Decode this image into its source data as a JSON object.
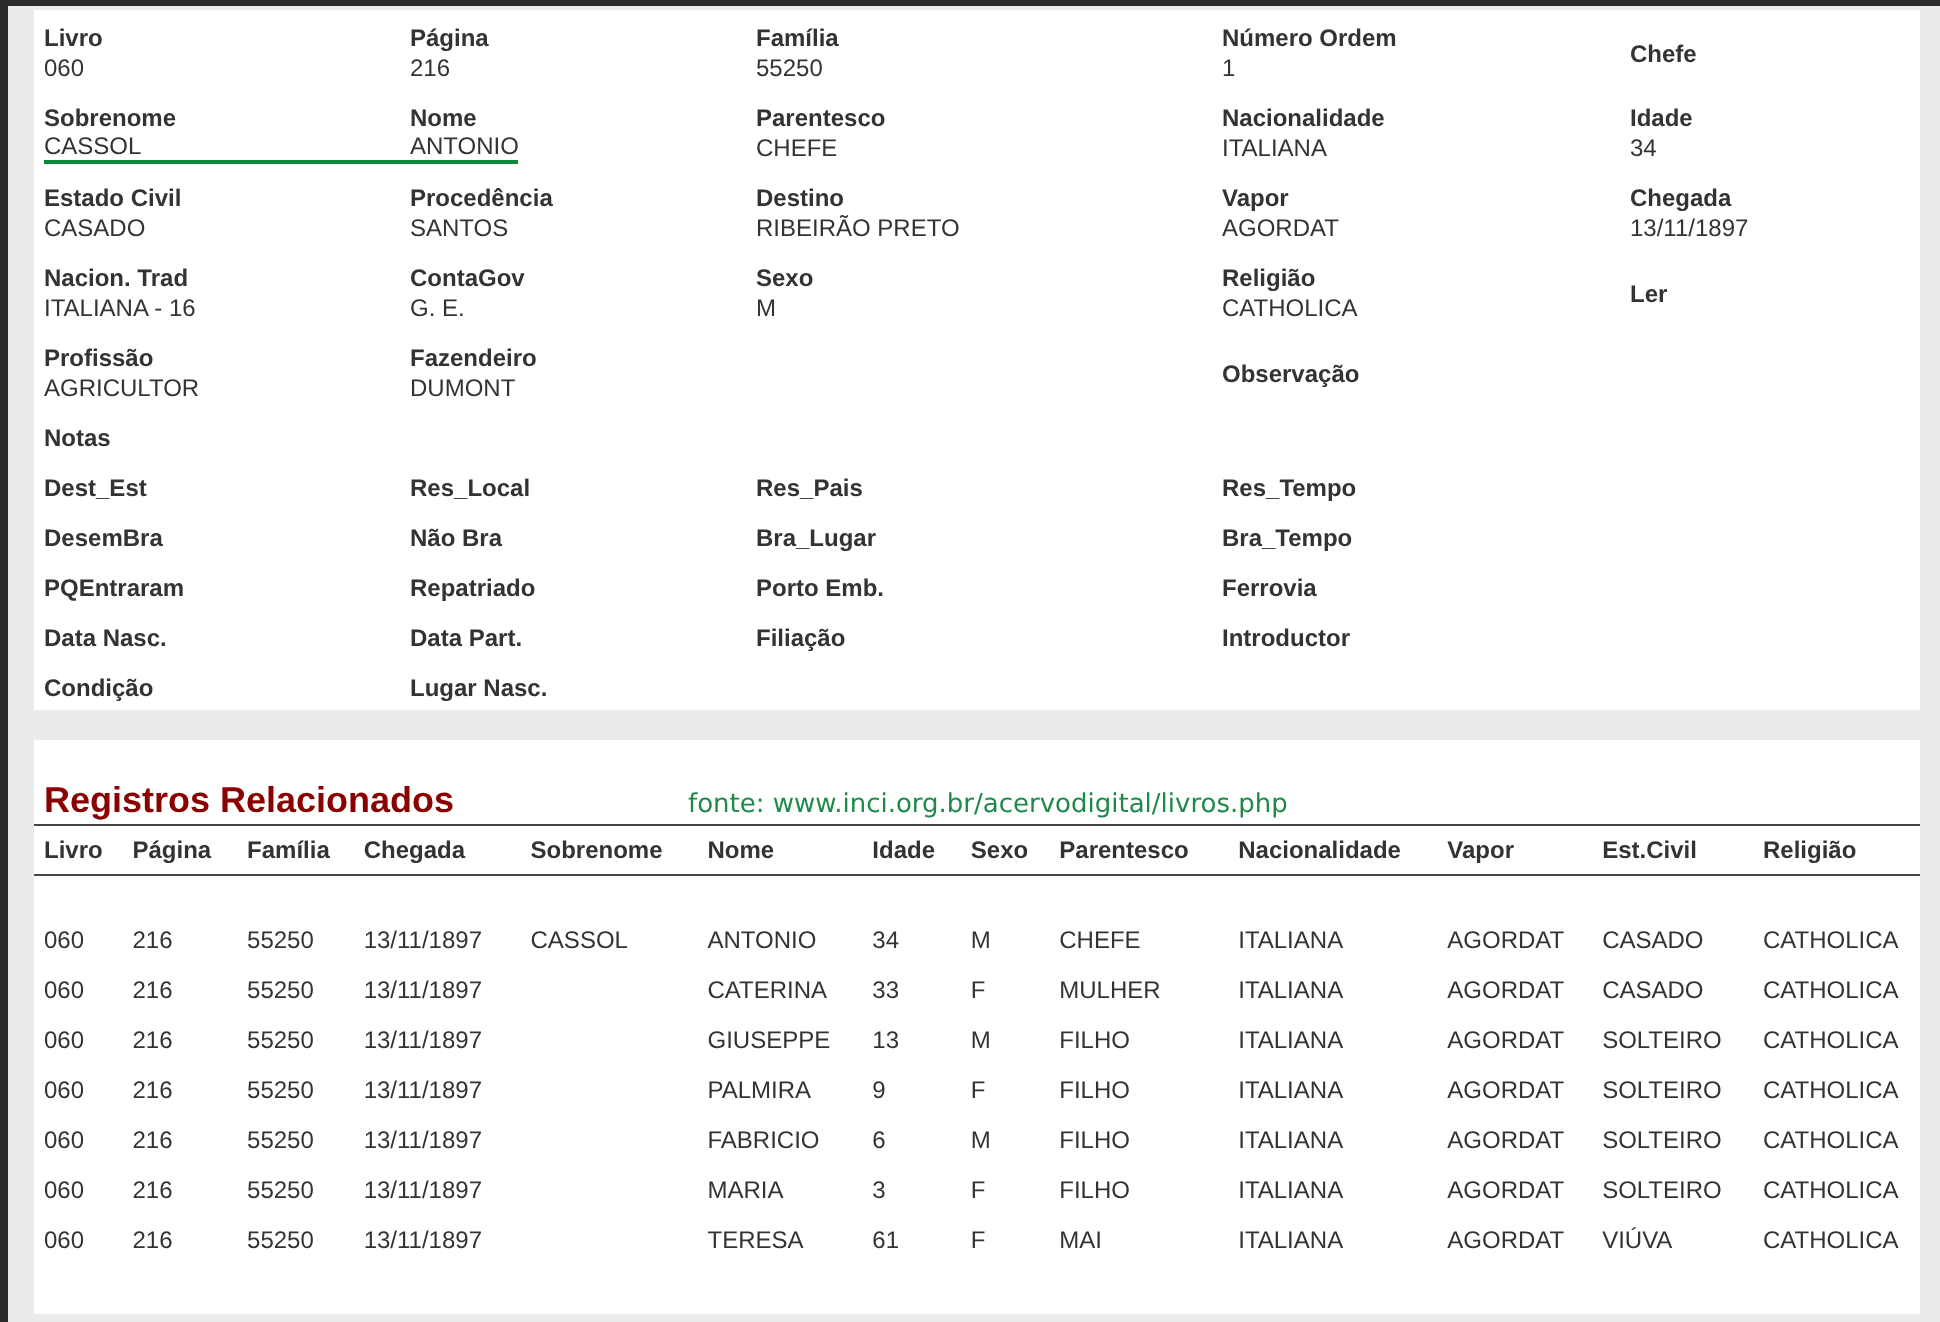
{
  "record": {
    "rows": [
      [
        {
          "label": "Livro",
          "value": "060"
        },
        {
          "label": "Página",
          "value": "216"
        },
        {
          "label": "Família",
          "value": "55250"
        },
        {
          "label": "Número Ordem",
          "value": "1"
        },
        {
          "label": "Chefe"
        }
      ],
      [
        {
          "label": "Sobrenome",
          "value": "CASSOL",
          "underlined": true
        },
        {
          "label": "Nome",
          "value": "ANTONIO",
          "underlined": true
        },
        {
          "label": "Parentesco",
          "value": "CHEFE",
          "underlined": false
        },
        {
          "label": "Nacionalidade",
          "value": "ITALIANA",
          "underlined": false
        },
        {
          "label": "Idade",
          "value": "34",
          "underlined": false
        }
      ],
      [
        {
          "label": "Estado Civil",
          "value": "CASADO"
        },
        {
          "label": "Procedência",
          "value": "SANTOS"
        },
        {
          "label": "Destino",
          "value": "RIBEIRÃO PRETO"
        },
        {
          "label": "Vapor",
          "value": "AGORDAT"
        },
        {
          "label": "Chegada",
          "value": "13/11/1897"
        }
      ],
      [
        {
          "label": "Nacion. Trad",
          "value": "ITALIANA - 16"
        },
        {
          "label": "ContaGov",
          "value": "G. E."
        },
        {
          "label": "Sexo",
          "value": "M"
        },
        {
          "label": "Religião",
          "value": "CATHOLICA"
        },
        {
          "label": "Ler"
        }
      ],
      [
        {
          "label": "Profissão",
          "value": "AGRICULTOR"
        },
        {
          "label": "Fazendeiro",
          "value": "DUMONT"
        },
        null,
        {
          "label": "Observação"
        },
        null
      ],
      [
        {
          "label": "Notas"
        },
        null,
        null,
        null,
        null
      ],
      [
        {
          "label": "Dest_Est"
        },
        {
          "label": "Res_Local"
        },
        {
          "label": "Res_Pais"
        },
        {
          "label": "Res_Tempo"
        },
        null
      ],
      [
        {
          "label": "DesemBra"
        },
        {
          "label": "Não Bra"
        },
        {
          "label": "Bra_Lugar"
        },
        {
          "label": "Bra_Tempo"
        },
        null
      ],
      [
        {
          "label": "PQEntraram"
        },
        {
          "label": "Repatriado"
        },
        {
          "label": "Porto Emb."
        },
        {
          "label": "Ferrovia"
        },
        null
      ],
      [
        {
          "label": "Data Nasc."
        },
        {
          "label": "Data Part."
        },
        {
          "label": "Filiação"
        },
        {
          "label": "Introductor"
        },
        null
      ],
      [
        {
          "label": "Condição"
        },
        {
          "label": "Lugar Nasc."
        },
        null,
        null,
        null
      ]
    ]
  },
  "related": {
    "title": "Registros Relacionados",
    "source_note": "fonte: www.inci.org.br/acervodigital/livros.php",
    "columns": [
      "Livro",
      "Página",
      "Família",
      "Chegada",
      "Sobrenome",
      "Nome",
      "Idade",
      "Sexo",
      "Parentesco",
      "Nacionalidade",
      "Vapor",
      "Est.Civil",
      "Religião"
    ],
    "rows": [
      [
        "060",
        "216",
        "55250",
        "13/11/1897",
        "CASSOL",
        "ANTONIO",
        "34",
        "M",
        "CHEFE",
        "ITALIANA",
        "AGORDAT",
        "CASADO",
        "CATHOLICA"
      ],
      [
        "060",
        "216",
        "55250",
        "13/11/1897",
        "",
        "CATERINA",
        "33",
        "F",
        "MULHER",
        "ITALIANA",
        "AGORDAT",
        "CASADO",
        "CATHOLICA"
      ],
      [
        "060",
        "216",
        "55250",
        "13/11/1897",
        "",
        "GIUSEPPE",
        "13",
        "M",
        "FILHO",
        "ITALIANA",
        "AGORDAT",
        "SOLTEIRO",
        "CATHOLICA"
      ],
      [
        "060",
        "216",
        "55250",
        "13/11/1897",
        "",
        "PALMIRA",
        "9",
        "F",
        "FILHO",
        "ITALIANA",
        "AGORDAT",
        "SOLTEIRO",
        "CATHOLICA"
      ],
      [
        "060",
        "216",
        "55250",
        "13/11/1897",
        "",
        "FABRICIO",
        "6",
        "M",
        "FILHO",
        "ITALIANA",
        "AGORDAT",
        "SOLTEIRO",
        "CATHOLICA"
      ],
      [
        "060",
        "216",
        "55250",
        "13/11/1897",
        "",
        "MARIA",
        "3",
        "F",
        "FILHO",
        "ITALIANA",
        "AGORDAT",
        "SOLTEIRO",
        "CATHOLICA"
      ],
      [
        "060",
        "216",
        "55250",
        "13/11/1897",
        "",
        "TERESA",
        "61",
        "F",
        "MAI",
        "ITALIANA",
        "AGORDAT",
        "VIÚVA",
        "CATHOLICA"
      ]
    ]
  }
}
